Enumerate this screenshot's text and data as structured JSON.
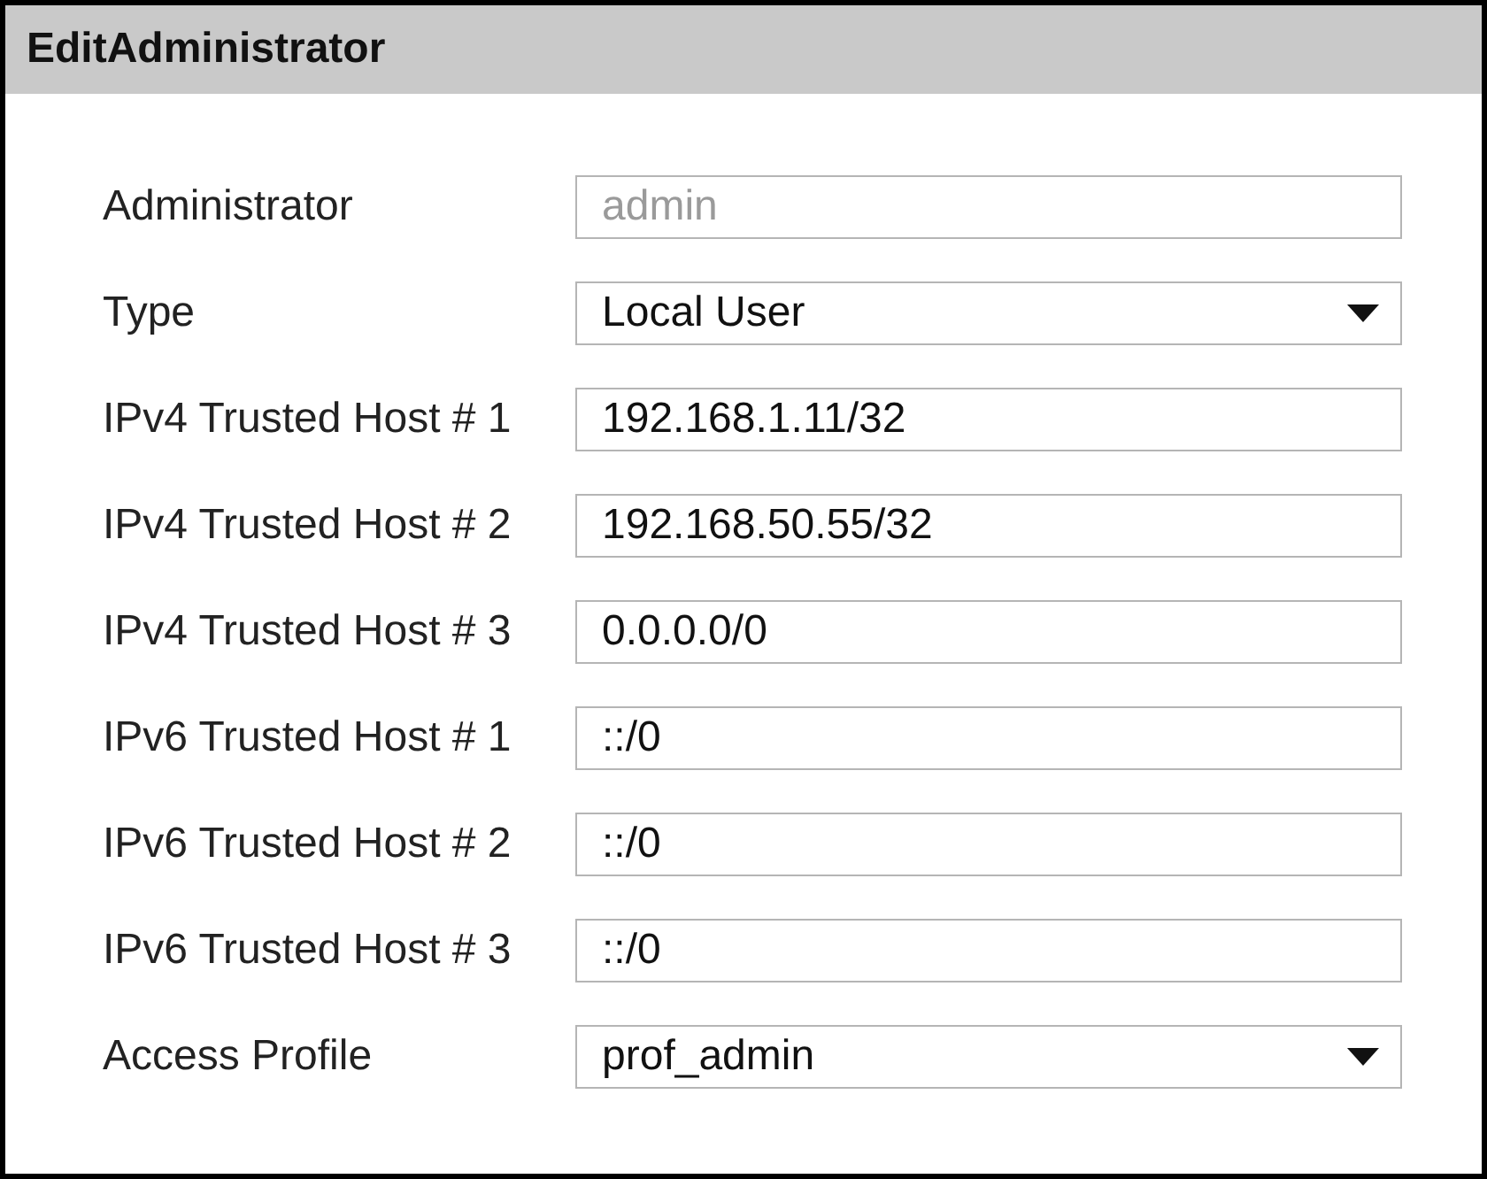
{
  "window": {
    "title": "EditAdministrator"
  },
  "fields": [
    {
      "label": "Administrator",
      "kind": "text",
      "value": "admin",
      "disabled": true
    },
    {
      "label": "Type",
      "kind": "select",
      "value": "Local User",
      "disabled": false
    },
    {
      "label": "IPv4 Trusted Host # 1",
      "kind": "text",
      "value": "192.168.1.11/32",
      "disabled": false
    },
    {
      "label": "IPv4 Trusted Host # 2",
      "kind": "text",
      "value": "192.168.50.55/32",
      "disabled": false
    },
    {
      "label": "IPv4 Trusted Host # 3",
      "kind": "text",
      "value": "0.0.0.0/0",
      "disabled": false
    },
    {
      "label": "IPv6 Trusted Host # 1",
      "kind": "text",
      "value": "::/0",
      "disabled": false
    },
    {
      "label": "IPv6 Trusted Host # 2",
      "kind": "text",
      "value": "::/0",
      "disabled": false
    },
    {
      "label": "IPv6 Trusted Host # 3",
      "kind": "text",
      "value": "::/0",
      "disabled": false
    },
    {
      "label": "Access Profile",
      "kind": "select",
      "value": "prof_admin",
      "disabled": false
    }
  ]
}
